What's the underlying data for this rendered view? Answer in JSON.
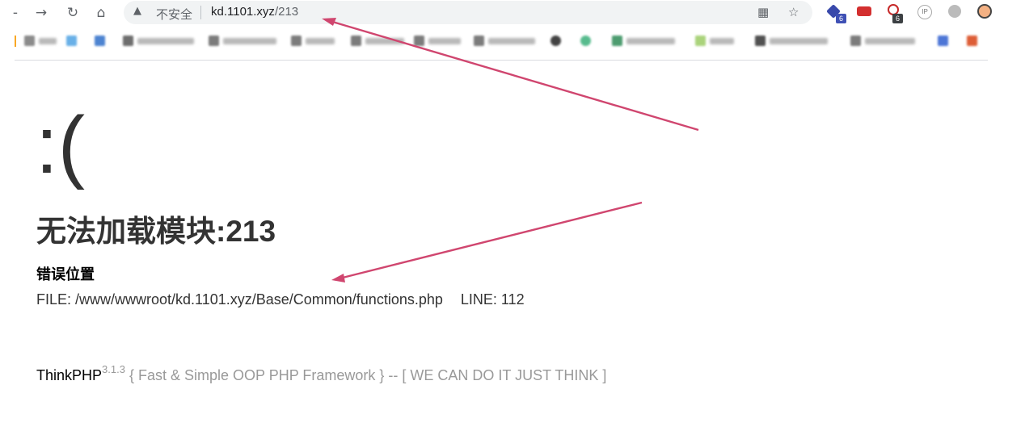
{
  "browser": {
    "back_glyph": "‑",
    "forward_glyph": "→",
    "reload_glyph": "↻",
    "home_glyph": "⌂",
    "security_warning": "不安全",
    "url_host": "kd.1101.xyz",
    "url_path": "/213",
    "extension_badges": [
      "6",
      "6"
    ],
    "extension_ip_label": "IP"
  },
  "error_page": {
    "face": ":(",
    "title": "无法加载模块:213",
    "location_heading": "错误位置",
    "file_label": "FILE: /www/wwwroot/kd.1101.xyz/Base/Common/functions.php",
    "line_label": "LINE: 112",
    "framework_name": "ThinkPHP",
    "framework_version": "3.1.3",
    "framework_slogan": "{ Fast & Simple OOP PHP Framework } -- [ WE CAN DO IT JUST THINK ]"
  },
  "colors": {
    "arrow": "#d0466f",
    "text": "#333333",
    "muted": "#999999"
  }
}
